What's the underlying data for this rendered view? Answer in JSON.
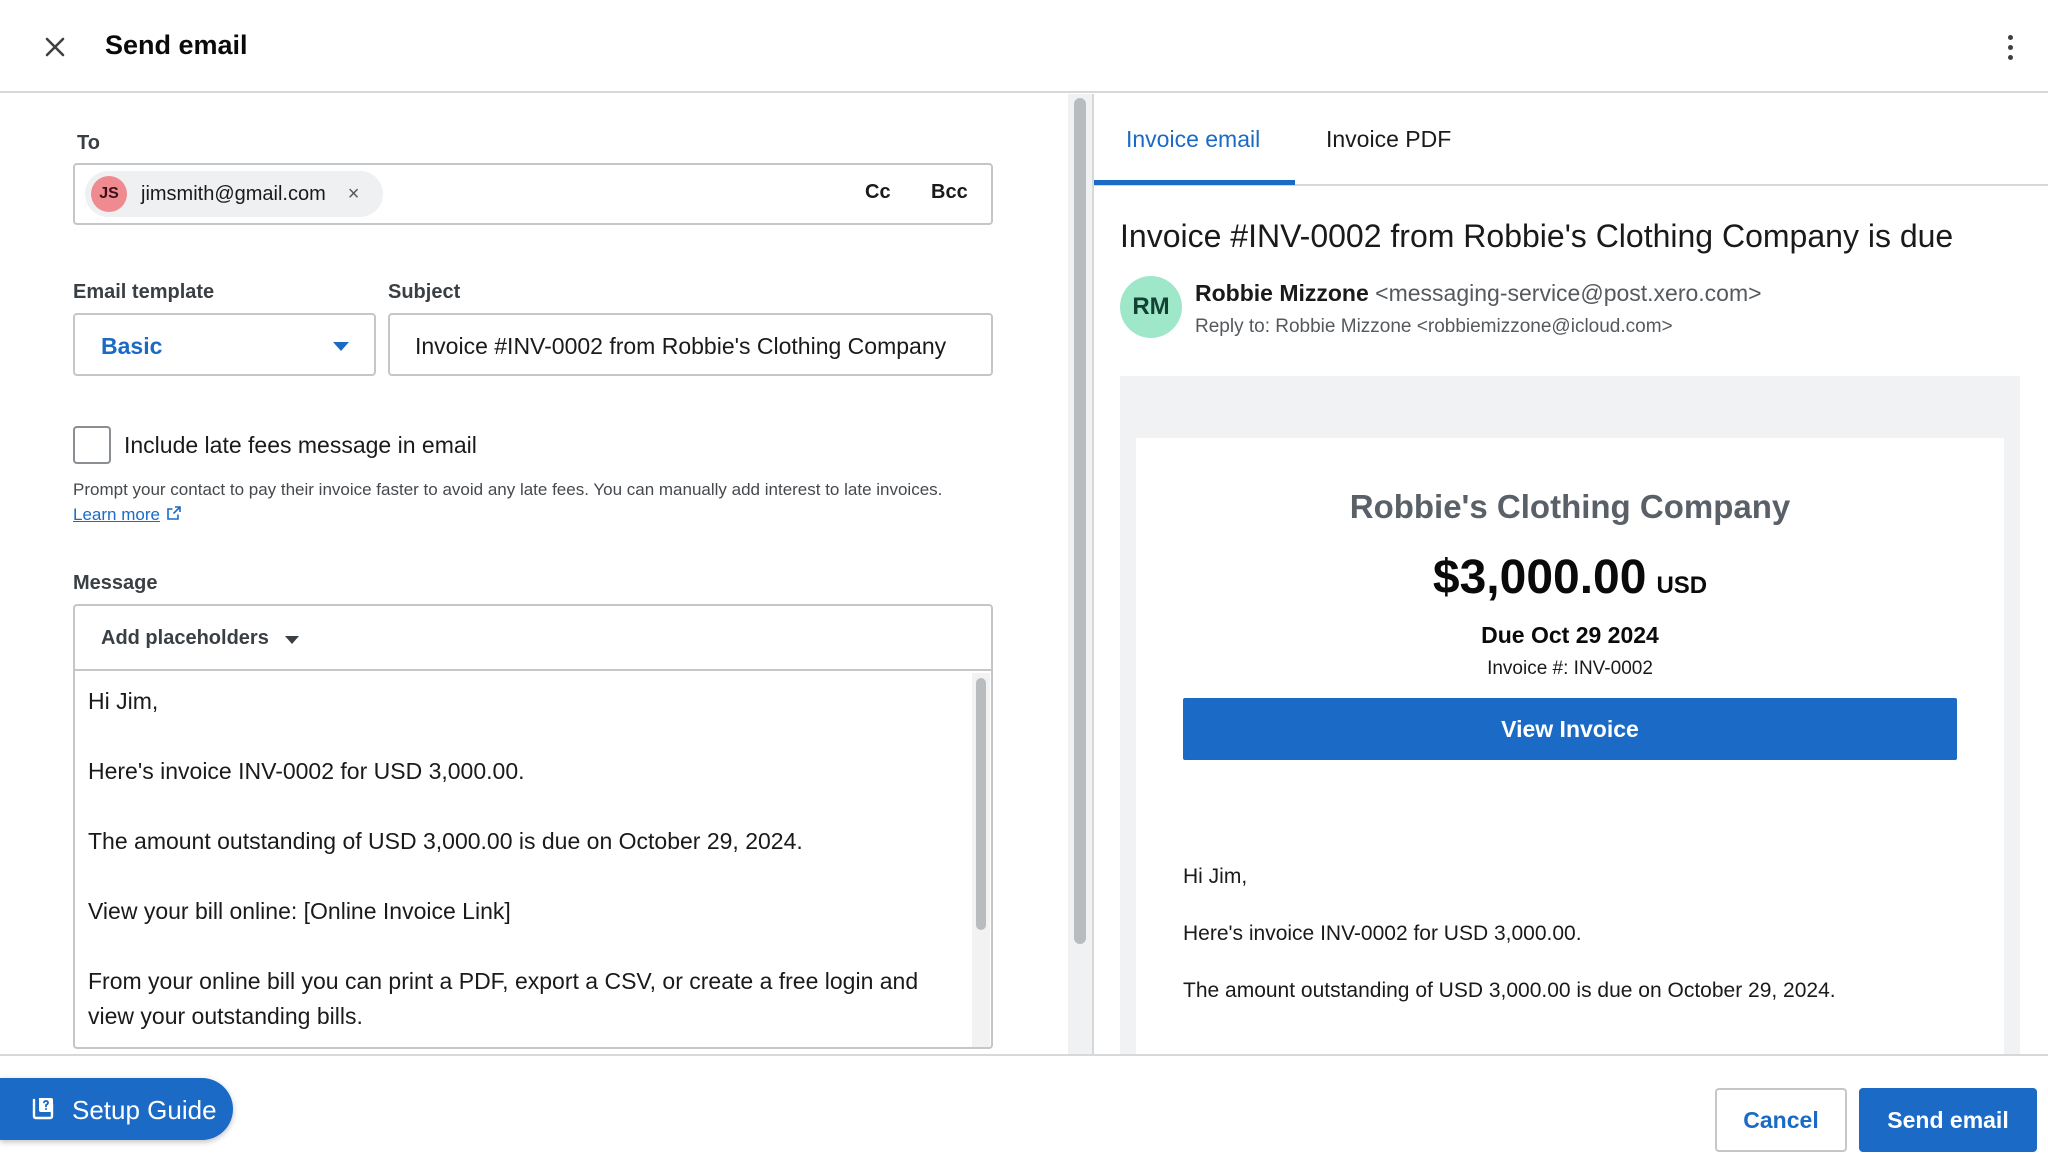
{
  "header": {
    "title": "Send email"
  },
  "form": {
    "to_label": "To",
    "recipient": {
      "initials": "JS",
      "email": "jimsmith@gmail.com",
      "remove_glyph": "×"
    },
    "cc_label": "Cc",
    "bcc_label": "Bcc",
    "template_label": "Email template",
    "template_value": "Basic",
    "subject_label": "Subject",
    "subject_value": "Invoice #INV-0002 from Robbie's Clothing Company",
    "late_fees_checked": false,
    "late_fees_label": "Include late fees message in email",
    "late_fees_help": "Prompt your contact to pay their invoice faster to avoid any late fees. You can manually add interest to late invoices.",
    "learn_more_label": "Learn more",
    "message_label": "Message",
    "placeholders_label": "Add placeholders",
    "message_lines": [
      "Hi Jim,",
      "Here's invoice INV-0002 for USD 3,000.00.",
      "The amount outstanding of USD 3,000.00 is due on October 29, 2024.",
      "View your bill online: [Online Invoice Link]",
      "From your online bill you can print a PDF, export a CSV, or create a free login and view your outstanding bills."
    ]
  },
  "preview": {
    "tabs": [
      {
        "label": "Invoice email",
        "active": true
      },
      {
        "label": "Invoice PDF",
        "active": false
      }
    ],
    "subject": "Invoice #INV-0002 from Robbie's Clothing Company is due",
    "sender_initials": "RM",
    "sender_name": "Robbie Mizzone",
    "sender_address": "<messaging-service@post.xero.com>",
    "reply_to": "Reply to: Robbie Mizzone <robbiemizzone@icloud.com>",
    "company": "Robbie's Clothing Company",
    "amount": "$3,000.00",
    "currency": "USD",
    "due": "Due Oct 29 2024",
    "invoice_number": "Invoice #: INV-0002",
    "view_button": "View Invoice",
    "body_lines": [
      "Hi Jim,",
      "Here's invoice INV-0002 for USD 3,000.00.",
      "The amount outstanding of USD 3,000.00 is due on October 29, 2024."
    ]
  },
  "footer": {
    "setup_guide_label": "Setup Guide",
    "cancel_label": "Cancel",
    "send_label": "Send email"
  },
  "colors": {
    "accent": "#1b6ac6",
    "recipient_avatar": "#f08a91",
    "sender_avatar": "#9fe7c9"
  },
  "icons": {
    "close": "close-icon",
    "more": "kebab-menu-icon",
    "dropdown": "caret-down-icon",
    "external_link": "external-link-icon",
    "setup_guide": "guide-icon"
  }
}
